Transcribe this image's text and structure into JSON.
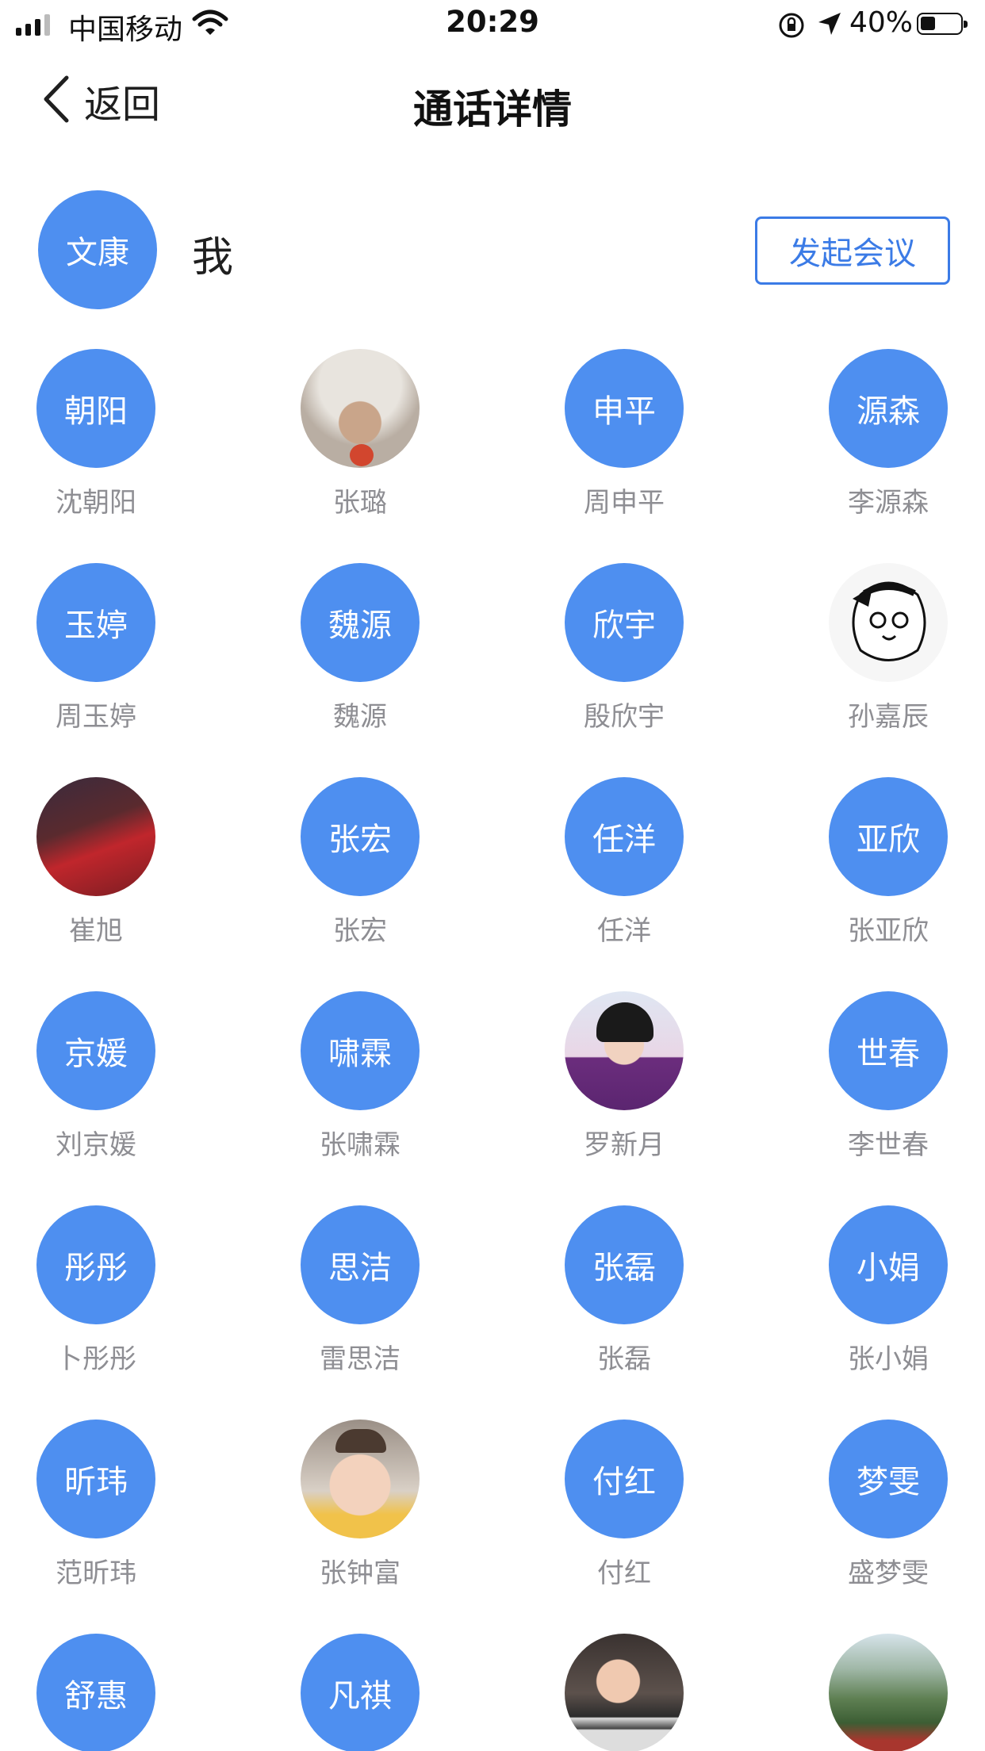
{
  "status_bar": {
    "carrier": "中国移动",
    "time": "20:29",
    "battery": "40%",
    "battery_level": 0.4
  },
  "nav": {
    "back_label": "返回",
    "title": "通话详情"
  },
  "self": {
    "avatar_text": "文康",
    "name": "我",
    "meeting_button": "发起会议"
  },
  "colors": {
    "accent": "#4e8ff0",
    "button_border": "#3b7be6",
    "name_gray": "#8e8e93"
  },
  "members": [
    {
      "avatar_text": "朝阳",
      "name": "沈朝阳"
    },
    {
      "avatar_text": "",
      "name": "张璐",
      "photo": "cat-photo"
    },
    {
      "avatar_text": "申平",
      "name": "周申平"
    },
    {
      "avatar_text": "源森",
      "name": "李源森"
    },
    {
      "avatar_text": "玉婷",
      "name": "周玉婷"
    },
    {
      "avatar_text": "魏源",
      "name": "魏源"
    },
    {
      "avatar_text": "欣宇",
      "name": "殷欣宇"
    },
    {
      "avatar_text": "",
      "name": "孙嘉辰",
      "photo": "manga-photo"
    },
    {
      "avatar_text": "",
      "name": "崔旭",
      "photo": "football-photo"
    },
    {
      "avatar_text": "张宏",
      "name": "张宏"
    },
    {
      "avatar_text": "任洋",
      "name": "任洋"
    },
    {
      "avatar_text": "亚欣",
      "name": "张亚欣"
    },
    {
      "avatar_text": "京媛",
      "name": "刘京媛"
    },
    {
      "avatar_text": "啸霖",
      "name": "张啸霖"
    },
    {
      "avatar_text": "",
      "name": "罗新月",
      "photo": "boy-photo"
    },
    {
      "avatar_text": "世春",
      "name": "李世春"
    },
    {
      "avatar_text": "彤彤",
      "name": "卜彤彤"
    },
    {
      "avatar_text": "思洁",
      "name": "雷思洁"
    },
    {
      "avatar_text": "张磊",
      "name": "张磊"
    },
    {
      "avatar_text": "小娟",
      "name": "张小娟"
    },
    {
      "avatar_text": "昕玮",
      "name": "范昕玮"
    },
    {
      "avatar_text": "",
      "name": "张钟富",
      "photo": "crying-child-photo"
    },
    {
      "avatar_text": "付红",
      "name": "付红"
    },
    {
      "avatar_text": "梦雯",
      "name": "盛梦雯"
    },
    {
      "avatar_text": "舒惠",
      "name": ""
    },
    {
      "avatar_text": "凡祺",
      "name": ""
    },
    {
      "avatar_text": "",
      "name": "",
      "photo": "baby-photo"
    },
    {
      "avatar_text": "",
      "name": "",
      "photo": "garden-photo"
    }
  ]
}
